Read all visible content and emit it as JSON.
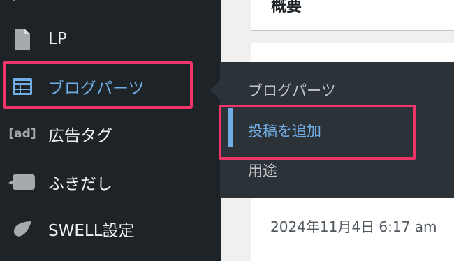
{
  "sidebar": {
    "items": [
      {
        "label": "LP",
        "icon": "page-icon"
      },
      {
        "label": "ブログパーツ",
        "icon": "block-layout-icon",
        "current": true
      },
      {
        "label": "広告タグ",
        "icon": "ad-icon",
        "icon_text": "[ad]"
      },
      {
        "label": "ふきだし",
        "icon": "speech-bubble-icon"
      },
      {
        "label": "SWELL設定",
        "icon": "swell-drop-icon"
      }
    ]
  },
  "flyout": {
    "items": [
      {
        "label": "ブログパーツ"
      },
      {
        "label": "投稿を追加",
        "active": true
      },
      {
        "label": "用途"
      }
    ]
  },
  "content": {
    "overview_title": "概要",
    "date_text": "2024年11月4日 6:17 am"
  },
  "colors": {
    "sidebar_bg": "#1d2327",
    "flyout_bg": "#2c3338",
    "accent_blue": "#72aee6",
    "highlight_pink": "#f0356b",
    "content_bg": "#f0f0f1"
  }
}
